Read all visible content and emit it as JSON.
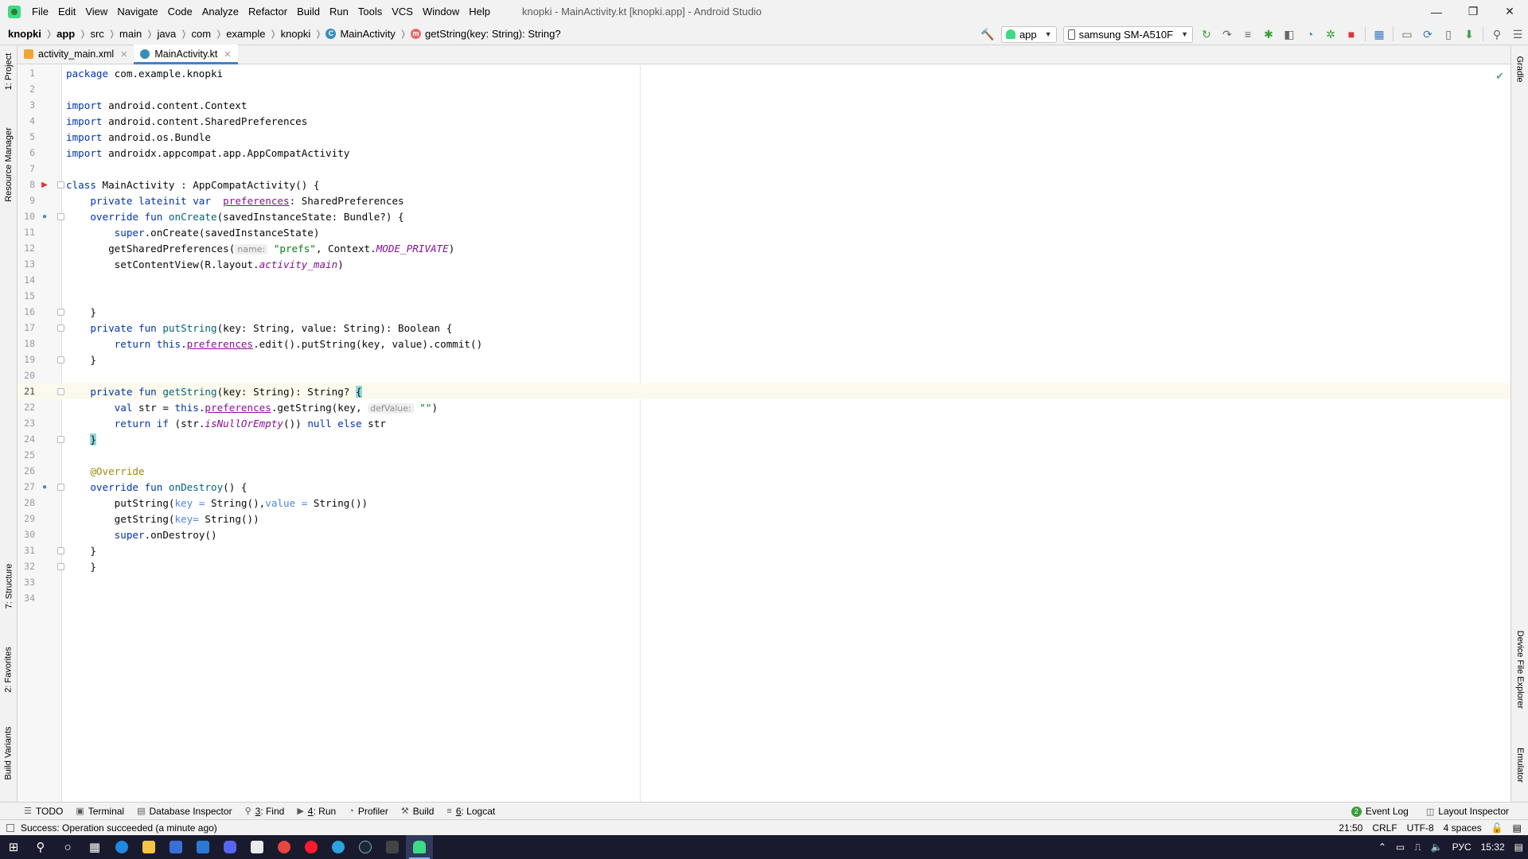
{
  "window": {
    "title": "knopki - MainActivity.kt [knopki.app] - Android Studio",
    "controls": [
      "—",
      "❐",
      "✕"
    ]
  },
  "menu": {
    "items": [
      "File",
      "Edit",
      "View",
      "Navigate",
      "Code",
      "Analyze",
      "Refactor",
      "Build",
      "Run",
      "Tools",
      "VCS",
      "Window",
      "Help"
    ]
  },
  "breadcrumb": {
    "items": [
      "knopki",
      "app",
      "src",
      "main",
      "java",
      "com",
      "example",
      "knopki",
      "MainActivity",
      "getString(key: String): String?"
    ]
  },
  "toolbar": {
    "run_config": "app",
    "device": "samsung SM-A510F"
  },
  "tabs": [
    {
      "label": "activity_main.xml"
    },
    {
      "label": "MainActivity.kt"
    }
  ],
  "left_panel": {
    "project": "1: Project",
    "resource_manager": "Resource Manager",
    "structure": "7: Structure",
    "favorites": "2: Favorites",
    "build_variants": "Build Variants"
  },
  "right_panel": {
    "gradle": "Gradle",
    "device_file_explorer": "Device File Explorer",
    "emulator": "Emulator"
  },
  "code": {
    "line_numbers": [
      "1",
      "2",
      "3",
      "4",
      "5",
      "6",
      "7",
      "8",
      "9",
      "10",
      "11",
      "12",
      "13",
      "14",
      "15",
      "16",
      "17",
      "18",
      "19",
      "20",
      "21",
      "22",
      "23",
      "24",
      "25",
      "26",
      "27",
      "28",
      "29",
      "30",
      "31",
      "32",
      "33",
      "34"
    ],
    "l1_kw": "package",
    "l1_rest": " com.example.knopki",
    "l3_kw": "import",
    "l3_rest": " android.content.Context",
    "l4_kw": "import",
    "l4_rest": " android.content.SharedPreferences",
    "l5_kw": "import",
    "l5_rest": " android.os.Bundle",
    "l6_kw": "import",
    "l6_rest": " androidx.appcompat.app.AppCompatActivity",
    "l8_kw": "class",
    "l8_rest": " MainActivity : AppCompatActivity() {",
    "l9_kw": "    private lateinit var",
    "l9_sp": "  ",
    "l9_prop": "preferences",
    "l9_rest": ": SharedPreferences",
    "l10_kw": "    override fun",
    "l10_fn": "onCreate",
    "l10_rest": "(savedInstanceState: Bundle?) {",
    "l11_kw": "        super",
    "l11_rest": ".onCreate(savedInstanceState)",
    "l12_pre": "       getSharedPreferences(",
    "l12_hint": "name:",
    "l12_str": "\"prefs\"",
    "l12_mid": ", Context.",
    "l12_ital": "MODE_PRIVATE",
    "l12_end": ")",
    "l13_pre": "        setContentView(R.layout.",
    "l13_ital": "activity_main",
    "l13_end": ")",
    "l16": "    }",
    "l17_kw": "    private fun",
    "l17_fn": "putString",
    "l17_rest": "(key: String, value: String): Boolean {",
    "l18_kw": "        return this",
    "l18_dot": ".",
    "l18_prop": "preferences",
    "l18_rest": ".edit().putString(key, value).commit()",
    "l19": "    }",
    "l21_kw": "    private fun",
    "l21_fn": "getString",
    "l21_rest": "(key: String): String? ",
    "l21_brace": "{",
    "l22_kw": "        val",
    "l22_mid": " str = ",
    "l22_kw2": "this",
    "l22_dot": ".",
    "l22_prop": "preferences",
    "l22_rest": ".getString(key, ",
    "l22_hint": "defValue:",
    "l22_str": "\"\"",
    "l22_end": ")",
    "l23_kw": "        return if",
    "l23_mid": " (str.",
    "l23_ital": "isNullOrEmpty",
    "l23_mid2": "()) ",
    "l23_kw2": "null else",
    "l23_end": " str",
    "l24_sp": "    ",
    "l24_brace": "}",
    "l26": "    @Override",
    "l27_kw": "    override fun",
    "l27_fn": "onDestroy",
    "l27_rest": "() {",
    "l28_pre": "        putString(",
    "l28_p1": "key =",
    "l28_mid": " String(),",
    "l28_p2": "value =",
    "l28_end": " String())",
    "l29_pre": "        getString(",
    "l29_p1": "key=",
    "l29_end": " String())",
    "l30_kw": "        super",
    "l30_rest": ".onDestroy()",
    "l31": "    }",
    "l32": "    }"
  },
  "bottom_tools": {
    "todo": "TODO",
    "terminal": "Terminal",
    "database_inspector": "Database Inspector",
    "find_num": "3",
    "find": ": Find",
    "run_num": "4",
    "run": ": Run",
    "profiler": "Profiler",
    "build": "Build",
    "logcat_num": "6",
    "logcat": ": Logcat",
    "event_log_count": "2",
    "event_log": "Event Log",
    "layout_inspector": "Layout Inspector"
  },
  "status": {
    "message": "Success: Operation succeeded (a minute ago)",
    "position": "21:50",
    "line_sep": "CRLF",
    "encoding": "UTF-8",
    "indent": "4 spaces"
  },
  "taskbar": {
    "lang": "РУС",
    "time": "15:32"
  },
  "colors": {
    "keyword": "#0033b3",
    "function": "#00627a",
    "string": "#067d17",
    "property": "#871094",
    "accent": "#4083c9"
  }
}
